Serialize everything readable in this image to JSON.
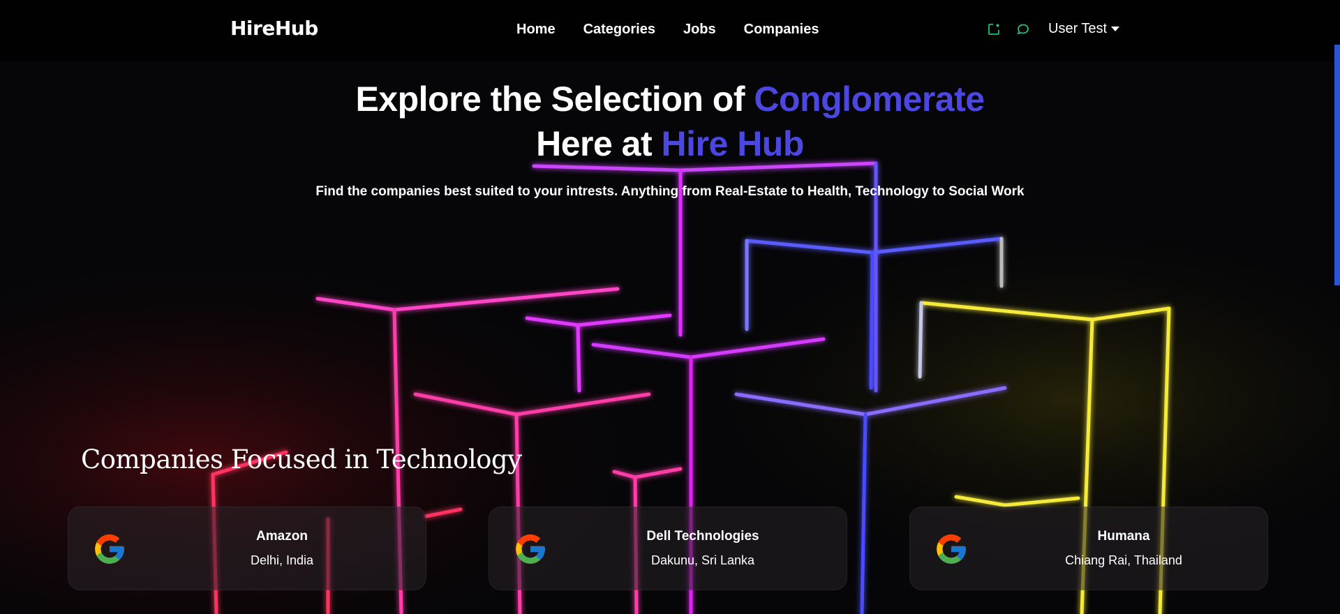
{
  "brand": "HireHub",
  "nav": {
    "links": [
      {
        "label": "Home"
      },
      {
        "label": "Categories"
      },
      {
        "label": "Jobs"
      },
      {
        "label": "Companies"
      }
    ],
    "icons": [
      "notification-icon",
      "chat-icon"
    ],
    "icon_color": "#22c07a",
    "user": "User Test"
  },
  "hero": {
    "line1_prefix": "Explore the Selection of ",
    "line1_accent": "Conglomerate",
    "line2_prefix": "Here at ",
    "line2_accent": "Hire Hub",
    "subtitle": "Find the companies best suited to your intrests. Anything from Real-Estate to Health, Technology to Social Work",
    "accent_color": "#4b47e0"
  },
  "section": {
    "title": "Companies Focused in Technology"
  },
  "companies": [
    {
      "name": "Amazon",
      "location": "Delhi, India",
      "logo": "google-logo-icon"
    },
    {
      "name": "Dell Technologies",
      "location": "Dakunu, Sri Lanka",
      "logo": "google-logo-icon"
    },
    {
      "name": "Humana",
      "location": "Chiang Rai, Thailand",
      "logo": "google-logo-icon"
    }
  ],
  "background": {
    "description_colors": [
      "#ff2fd0",
      "#ff3b7a",
      "#4a4cff",
      "#f4e63a"
    ]
  }
}
